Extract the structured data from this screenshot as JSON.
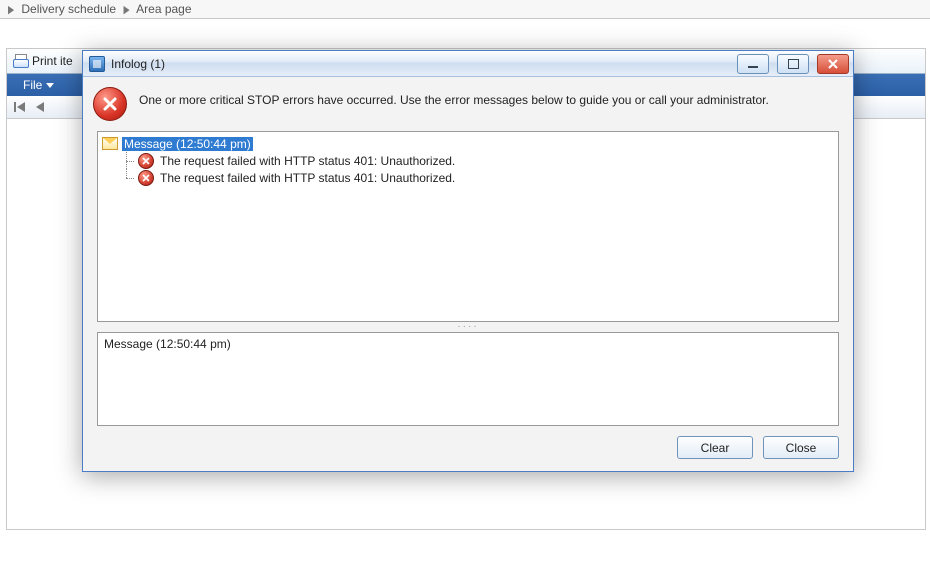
{
  "breadcrumb": {
    "item1": "Delivery schedule",
    "item2": "Area page"
  },
  "background_window": {
    "title": "Print ite",
    "menu_file": "File"
  },
  "dialog": {
    "title": "Infolog (1)",
    "instruction": "One or more critical STOP errors have occurred. Use the error messages below to guide you or call your administrator.",
    "tree": {
      "root_label": "Message (12:50:44 pm)",
      "child1": "The request failed with HTTP status 401: Unauthorized.",
      "child2": "The request failed with HTTP status 401: Unauthorized."
    },
    "detail_text": "Message (12:50:44 pm)",
    "btn_clear": "Clear",
    "btn_close": "Close"
  }
}
